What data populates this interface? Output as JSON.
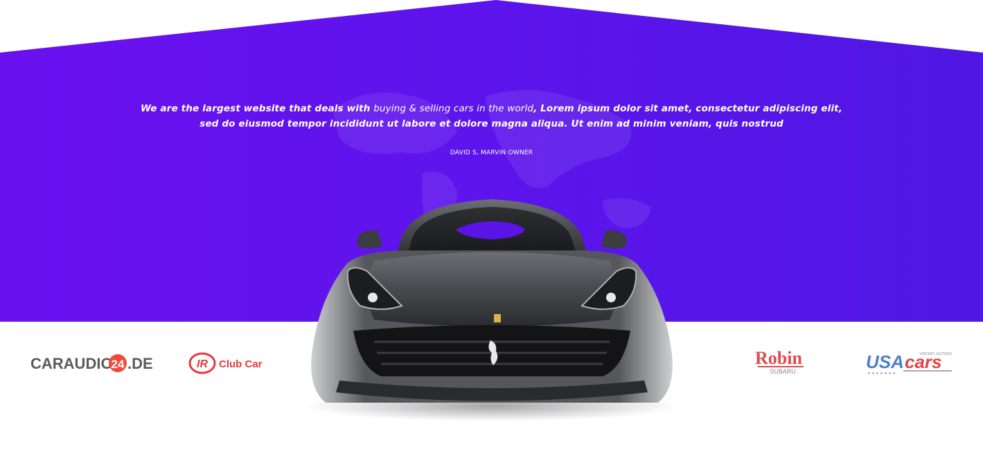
{
  "testimonial": {
    "quote_part1": "We are the largest website that deals with ",
    "quote_part2": "buying & selling cars in the world",
    "quote_part3": ", Lorem ipsum dolor sit amet, consectetur adipiscing elit, sed do eiusmod tempor incididunt ut labore et dolore magna aliqua. Ut enim ad minim veniam, quis nostrud",
    "author": "DAVID S, MARVIN OWNER"
  },
  "brands": [
    {
      "name": "CARAUDIO24.DE",
      "text_left": "CARAUDIO",
      "badge": "24",
      "text_right": ".DE"
    },
    {
      "name": "Club Car",
      "badge": "IR",
      "text": "Club Car"
    },
    {
      "name": "Robin Subaru",
      "text": "Robin",
      "subtext": "SUBARU"
    },
    {
      "name": "USA cars",
      "text_left": "USA",
      "text_right": "cars",
      "tagline": "VINCENT LEIJTENS"
    }
  ],
  "colors": {
    "hero_gradient_start": "#6a10ef",
    "hero_gradient_end": "#4f17e3",
    "caraudio_badge": "#ef4b3d",
    "clubcar_red": "#e8383a",
    "robin_red": "#e04a4a",
    "usacars_blue": "#4a7fd0",
    "usacars_red": "#e0454a"
  }
}
